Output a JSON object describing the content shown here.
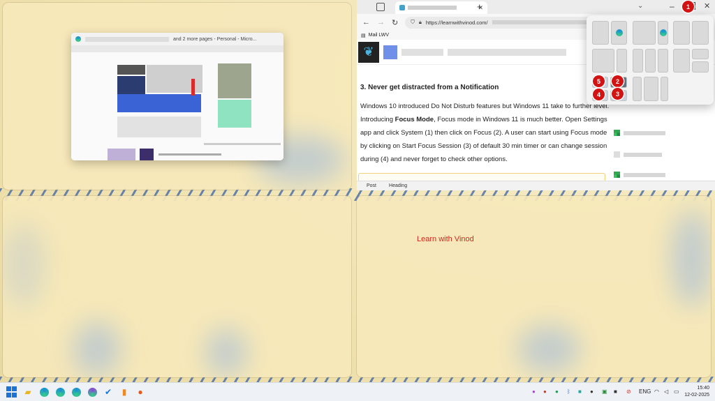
{
  "thumbnail": {
    "title_suffix": "and 2 more pages - Personal - Micro..."
  },
  "browser": {
    "url": "https://learnwithvinod.com/",
    "favorites_item": "Mail LWV",
    "article_heading": "3. Never get distracted from a Notification",
    "article_para_pre": "Windows 10 introduced Do Not Disturb features but Windows 11 take to further level. Introducing ",
    "article_bold": "Focus Mode",
    "article_para_post": ", Focus mode in Windows 11 is much better. Open Settings app and click System (1) then click on Focus (2). A user can start using Focus mode by clicking on Start Focus Session (3) of default 30 min timer or can change session during (4) and never forget to check other options.",
    "status_items": [
      "Post",
      "Heading"
    ]
  },
  "snap_badges": {
    "b1": "1",
    "b2": "2",
    "b3": "3",
    "b4": "4",
    "b5": "5"
  },
  "watermark": "Learn with Vinod",
  "taskbar": {
    "lang": "ENG",
    "time": "15:40",
    "date": "12-02-2025"
  },
  "colors": {
    "badge": "#d21313",
    "accent": "#1a73d9",
    "watermark": "#d4281c"
  }
}
